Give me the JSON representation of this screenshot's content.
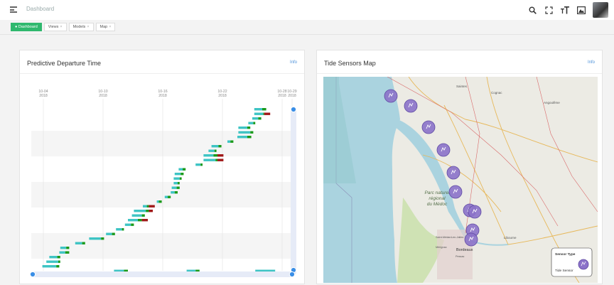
{
  "header": {
    "title": "Dashboard",
    "tool_icons": [
      "search-icon",
      "fullscreen-icon",
      "text-size-icon",
      "image-icon"
    ]
  },
  "tabs": [
    {
      "label": "Dashboard",
      "active": true
    },
    {
      "label": "Views",
      "active": false
    },
    {
      "label": "Models",
      "active": false
    },
    {
      "label": "Map",
      "active": false
    }
  ],
  "left_card": {
    "title": "Predictive Departure Time",
    "info": "Info"
  },
  "right_card": {
    "title": "Tide Sensors Map",
    "info": "Info"
  },
  "colors": {
    "accent": "#2fb86e",
    "teal": "#3ec4c4",
    "green": "#1a9a1a",
    "red": "#a01818",
    "sensor": "#8b72c9"
  },
  "chart_data": {
    "type": "timeline",
    "x_ticks": [
      {
        "date": "10-04",
        "year": "2018",
        "pos": 0
      },
      {
        "date": "10-10",
        "year": "2018",
        "pos": 6
      },
      {
        "date": "10-16",
        "year": "2018",
        "pos": 12
      },
      {
        "date": "10-22",
        "year": "2018",
        "pos": 18
      },
      {
        "date": "10-28",
        "year": "2018",
        "pos": 24
      },
      {
        "date": "10-29",
        "year": "2018",
        "pos": 25
      }
    ],
    "bars": [
      {
        "row": 0,
        "start": 21.2,
        "teal": 0.8,
        "green": 0.4,
        "red": 0
      },
      {
        "row": 1,
        "start": 21.2,
        "teal": 0.9,
        "green": 0.1,
        "red": 0.6
      },
      {
        "row": 2,
        "start": 21.0,
        "teal": 0.6,
        "green": 0.3,
        "red": 0
      },
      {
        "row": 3,
        "start": 20.6,
        "teal": 0.5,
        "green": 0.2,
        "red": 0
      },
      {
        "row": 4,
        "start": 19.6,
        "teal": 0.9,
        "green": 0.3,
        "red": 0
      },
      {
        "row": 5,
        "start": 19.6,
        "teal": 1.2,
        "green": 0.3,
        "red": 0
      },
      {
        "row": 6,
        "start": 19.5,
        "teal": 1.0,
        "green": 0.4,
        "red": 0
      },
      {
        "row": 7,
        "start": 18.5,
        "teal": 0.3,
        "green": 0.3,
        "red": 0
      },
      {
        "row": 8,
        "start": 16.9,
        "teal": 0.7,
        "green": 0.3,
        "red": 0
      },
      {
        "row": 9,
        "start": 16.6,
        "teal": 0.6,
        "green": 0.2,
        "red": 0
      },
      {
        "row": 10,
        "start": 16.1,
        "teal": 1.0,
        "green": 0.4,
        "red": 0.6
      },
      {
        "row": 11,
        "start": 16.1,
        "teal": 1.2,
        "green": 0.2,
        "red": 0.6
      },
      {
        "row": 12,
        "start": 15.3,
        "teal": 0.5,
        "green": 0.2,
        "red": 0
      },
      {
        "row": 13,
        "start": 13.6,
        "teal": 0.4,
        "green": 0.3,
        "red": 0
      },
      {
        "row": 14,
        "start": 13.2,
        "teal": 0.6,
        "green": 0.3,
        "red": 0
      },
      {
        "row": 15,
        "start": 13.1,
        "teal": 0.6,
        "green": 0.2,
        "red": 0
      },
      {
        "row": 16,
        "start": 13.1,
        "teal": 0.4,
        "green": 0.2,
        "red": 0
      },
      {
        "row": 17,
        "start": 12.9,
        "teal": 0.5,
        "green": 0.3,
        "red": 0
      },
      {
        "row": 18,
        "start": 12.8,
        "teal": 0.4,
        "green": 0.3,
        "red": 0
      },
      {
        "row": 19,
        "start": 12.2,
        "teal": 0.3,
        "green": 0.3,
        "red": 0
      },
      {
        "row": 20,
        "start": 11.4,
        "teal": 0.2,
        "green": 0.3,
        "red": 0
      },
      {
        "row": 21,
        "start": 10.0,
        "teal": 0.4,
        "green": 0.2,
        "red": 0.6
      },
      {
        "row": 22,
        "start": 9.1,
        "teal": 1.2,
        "green": 0.3,
        "red": 0.4
      },
      {
        "row": 23,
        "start": 8.9,
        "teal": 1.0,
        "green": 0.3,
        "red": 0
      },
      {
        "row": 24,
        "start": 8.5,
        "teal": 1.0,
        "green": 0.4,
        "red": 0.6
      },
      {
        "row": 25,
        "start": 8.2,
        "teal": 0.6,
        "green": 0.3,
        "red": 0
      },
      {
        "row": 26,
        "start": 7.3,
        "teal": 0.6,
        "green": 0.2,
        "red": 0
      },
      {
        "row": 27,
        "start": 6.3,
        "teal": 0.6,
        "green": 0.3,
        "red": 0
      },
      {
        "row": 28,
        "start": 4.6,
        "teal": 1.2,
        "green": 0.3,
        "red": 0
      },
      {
        "row": 29,
        "start": 3.2,
        "teal": 0.7,
        "green": 0.3,
        "red": 0
      },
      {
        "row": 30,
        "start": 1.7,
        "teal": 0.6,
        "green": 0.3,
        "red": 0
      },
      {
        "row": 31,
        "start": 1.6,
        "teal": 0.6,
        "green": 0.4,
        "red": 0
      },
      {
        "row": 32,
        "start": 0.6,
        "teal": 0.8,
        "green": 0.3,
        "red": 0
      },
      {
        "row": 33,
        "start": 0.3,
        "teal": 1.2,
        "green": 0.2,
        "red": 0
      },
      {
        "row": 34,
        "start": -0.1,
        "teal": 1.4,
        "green": 0.3,
        "red": 0
      },
      {
        "row": 35,
        "start": 7.1,
        "teal": 1.0,
        "green": 0.4,
        "red": 0
      },
      {
        "row": 36,
        "start": 14.4,
        "teal": 0.9,
        "green": 0.4,
        "red": 0
      },
      {
        "row": 37,
        "start": 21.3,
        "teal": 2.0,
        "green": 0,
        "red": 0
      }
    ],
    "bar_rows": [
      0,
      1,
      2,
      3,
      4,
      5,
      6,
      7,
      8,
      9,
      10,
      11,
      12,
      13,
      14,
      15,
      16,
      17,
      18,
      19,
      20,
      21,
      22,
      23,
      24,
      25,
      26,
      27,
      28,
      29,
      30,
      31,
      32,
      33,
      34,
      35,
      35,
      35
    ]
  },
  "map": {
    "labels": [
      {
        "text": "Parc naturel",
        "italic": true
      },
      {
        "text": "régional",
        "italic": true
      },
      {
        "text": "du Médoc",
        "italic": true
      },
      {
        "text": "Saintes",
        "italic": false
      },
      {
        "text": "Cognac",
        "italic": false
      },
      {
        "text": "Angoulême",
        "italic": false
      },
      {
        "text": "Bordeaux",
        "italic": false
      },
      {
        "text": "Libourne",
        "italic": false
      },
      {
        "text": "Saint-Médard-en-Jalles",
        "italic": false
      },
      {
        "text": "Mérignac",
        "italic": false
      },
      {
        "text": "Pessac",
        "italic": false
      }
    ],
    "legend": {
      "title": "Sensor Type",
      "item": "Tide Sensor"
    }
  }
}
